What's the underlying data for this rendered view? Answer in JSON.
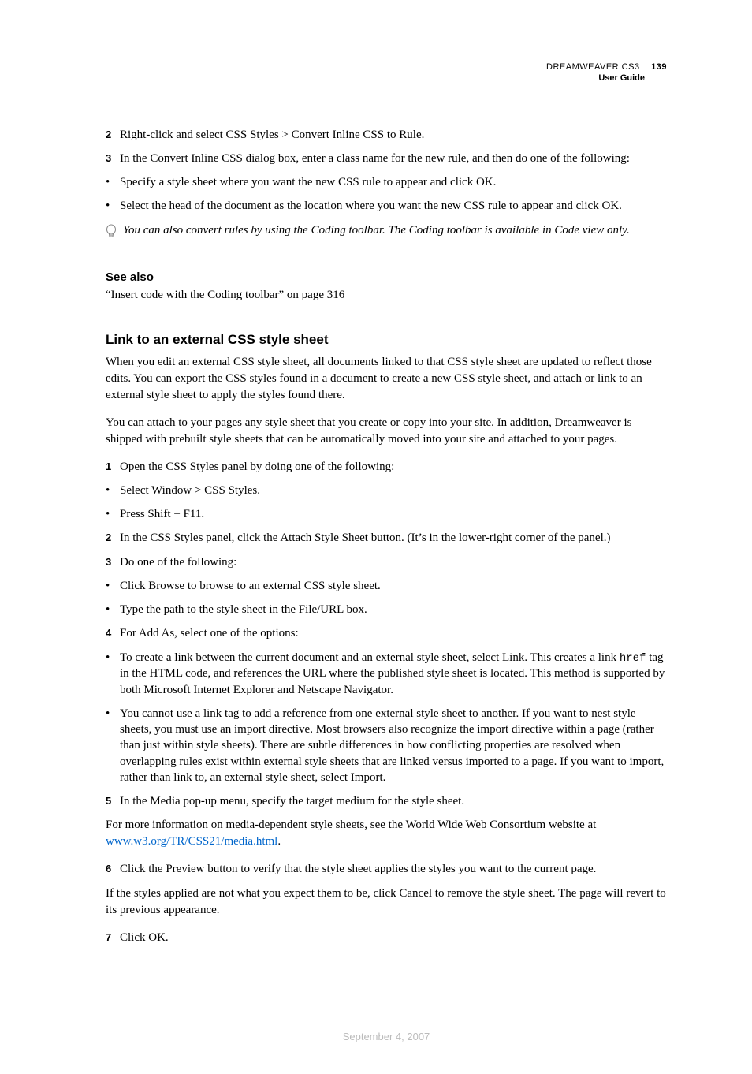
{
  "header": {
    "product": "DREAMWEAVER CS3",
    "pagenum": "139",
    "subtitle": "User Guide"
  },
  "step2": "Right-click and select CSS Styles > Convert Inline CSS to Rule.",
  "step3": "In the Convert Inline CSS dialog box, enter a class name for the new rule, and then do one of the following:",
  "step3_b1": "Specify a style sheet where you want the new CSS rule to appear and click OK.",
  "step3_b2": "Select the head of the document as the location where you want the new CSS rule to appear and click OK.",
  "tip": "You can also convert rules by using the Coding toolbar. The Coding toolbar is available in Code view only.",
  "see_also_heading": "See also",
  "see_also_text": "“Insert code with the Coding toolbar” on page 316",
  "section_heading": "Link to an external CSS style sheet",
  "para1": "When you edit an external CSS style sheet, all documents linked to that CSS style sheet are updated to reflect those edits. You can export the CSS styles found in a document to create a new CSS style sheet, and attach or link to an external style sheet to apply the styles found there.",
  "para2": "You can attach to your pages any style sheet that you create or copy into your site. In addition, Dreamweaver is shipped with prebuilt style sheets that can be automatically moved into your site and attached to your pages.",
  "s1": "Open the CSS Styles panel by doing one of the following:",
  "s1_b1": "Select Window > CSS Styles.",
  "s1_b2": "Press Shift + F11.",
  "s2": "In the CSS Styles panel, click the Attach Style Sheet button. (It’s in the lower-right corner of the panel.)",
  "s3": "Do one of the following:",
  "s3_b1": "Click Browse to browse to an external CSS style sheet.",
  "s3_b2": "Type the path to the style sheet in the File/URL box.",
  "s4": "For Add As, select one of the options:",
  "s4_b1_a": "To create a link between the current document and an external style sheet, select Link. This creates a link ",
  "s4_b1_code": "href",
  "s4_b1_b": " tag in the HTML code, and references the URL where the published style sheet is located. This method is supported by both Microsoft Internet Explorer and Netscape Navigator.",
  "s4_b2": "You cannot use a link tag to add a reference from one external style sheet to another. If you want to nest style sheets, you must use an import directive. Most browsers also recognize the import directive within a page (rather than just within style sheets). There are subtle differences in how conflicting properties are resolved when overlapping rules exist within external style sheets that are linked versus imported to a page. If you want to import, rather than link to, an external style sheet, select Import.",
  "s5": "In the Media pop-up menu, specify the target medium for the style sheet.",
  "para_media_a": "For more information on media-dependent style sheets, see the World Wide Web Consortium website at ",
  "para_media_link": "www.w3.org/TR/CSS21/media.html",
  "para_media_b": ".",
  "s6": "Click the Preview button to verify that the style sheet applies the styles you want to the current page.",
  "para_cancel": "If the styles applied are not what you expect them to be, click Cancel to remove the style sheet. The page will revert to its previous appearance.",
  "s7": "Click OK.",
  "footer_date": "September 4, 2007"
}
